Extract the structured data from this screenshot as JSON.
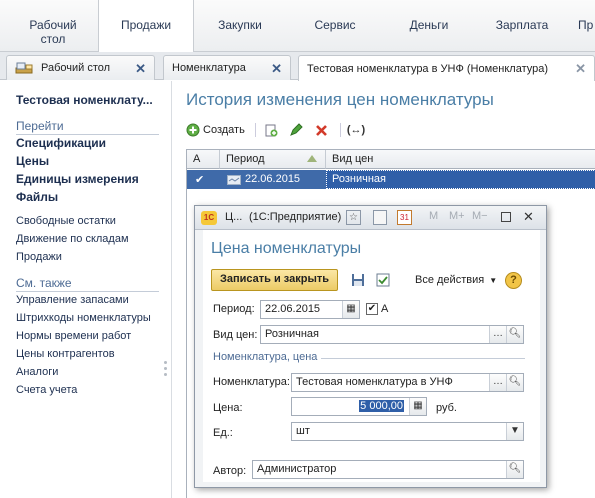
{
  "top_menu": [
    {
      "label": "Рабочий\nстол"
    },
    {
      "label": "Продажи"
    },
    {
      "label": "Закупки"
    },
    {
      "label": "Сервис"
    },
    {
      "label": "Деньги"
    },
    {
      "label": "Зарплата"
    },
    {
      "label": "Пр"
    }
  ],
  "tabs": [
    {
      "label": "Рабочий стол"
    },
    {
      "label": "Номенклатура"
    },
    {
      "label": "Тестовая номенклатура в УНФ (Номенклатура)"
    }
  ],
  "left_panel": {
    "title": "Тестовая номенклату...",
    "goto_header": "Перейти",
    "goto_items": [
      "Спецификации",
      "Цены",
      "Единицы измерения",
      "Файлы"
    ],
    "extra_items": [
      "Свободные остатки",
      "Движение по складам",
      "Продажи"
    ],
    "see_also_header": "См. также",
    "see_also_items": [
      "Управление запасами",
      "Штрихкоды номенклатуры",
      "Нормы времени работ",
      "Цены контрагентов",
      "Аналоги",
      "Счета учета"
    ]
  },
  "main": {
    "title": "История изменения цен номенклатуры",
    "create_label": "Создать",
    "grid_headers": {
      "a": "А",
      "period": "Период",
      "price_type": "Вид цен"
    },
    "row": {
      "period": "22.06.2015",
      "price_type": "Розничная"
    }
  },
  "modal": {
    "window_title": "Ц...",
    "app_title": "(1С:Предприятие)",
    "heading": "Цена номенклатуры",
    "save_close": "Записать и закрыть",
    "all_actions": "Все действия",
    "period_label": "Период:",
    "period_value": "22.06.2015",
    "a_label": "А",
    "price_type_label": "Вид цен:",
    "price_type_value": "Розничная",
    "group_label": "Номенклатура, цена",
    "nomenclature_label": "Номенклатура:",
    "nomenclature_value": "Тестовая номенклатура в УНФ",
    "price_label": "Цена:",
    "price_value": "5 000,00",
    "currency": "руб.",
    "unit_label": "Ед.:",
    "unit_value": "шт",
    "author_label": "Автор:",
    "author_value": "Администратор",
    "memory_buttons": [
      "M",
      "M+",
      "M−"
    ]
  },
  "colors": {
    "accent_blue": "#3f6aa9",
    "title_blue": "#4a7ea6",
    "save_button": "#f2d98a"
  }
}
